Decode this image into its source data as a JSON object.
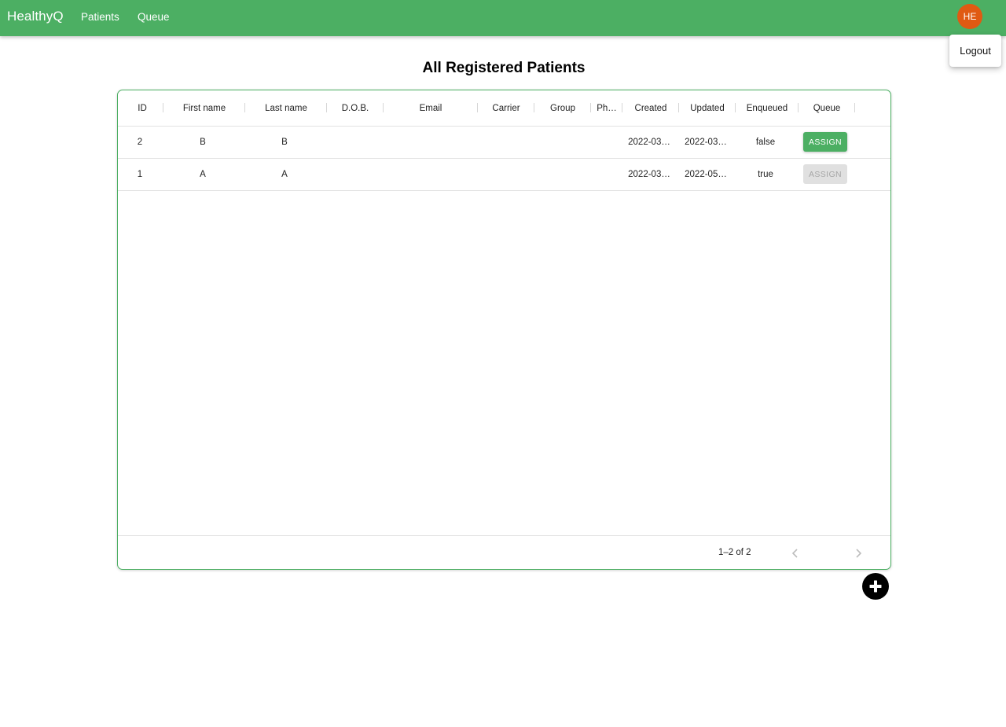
{
  "appbar": {
    "brand": "HealthyQ",
    "nav": [
      "Patients",
      "Queue"
    ],
    "avatar_initials": "HE",
    "color": "#4caf63",
    "avatar_color": "#e05a12"
  },
  "menu": {
    "items": [
      "Logout"
    ]
  },
  "page": {
    "title": "All Registered Patients"
  },
  "grid": {
    "columns": [
      "ID",
      "First name",
      "Last name",
      "D.O.B.",
      "Email",
      "Carrier",
      "Group",
      "Ph…",
      "Created",
      "Updated",
      "Enqueued",
      "Queue"
    ],
    "rows": [
      {
        "id": "2",
        "first_name": "B",
        "last_name": "B",
        "dob": "",
        "email": "",
        "carrier": "",
        "group": "",
        "phone": "",
        "created": "2022-03…",
        "updated": "2022-03…",
        "enqueued": "false",
        "action": "ASSIGN",
        "action_enabled": true
      },
      {
        "id": "1",
        "first_name": "A",
        "last_name": "A",
        "dob": "",
        "email": "",
        "carrier": "",
        "group": "",
        "phone": "",
        "created": "2022-03…",
        "updated": "2022-05…",
        "enqueued": "true",
        "action": "ASSIGN",
        "action_enabled": false
      }
    ],
    "pagination": {
      "range_text": "1–2 of 2",
      "prev_icon": "chevron-left-icon",
      "next_icon": "chevron-right-icon"
    }
  },
  "fab": {
    "icon": "plus-circle-icon"
  }
}
